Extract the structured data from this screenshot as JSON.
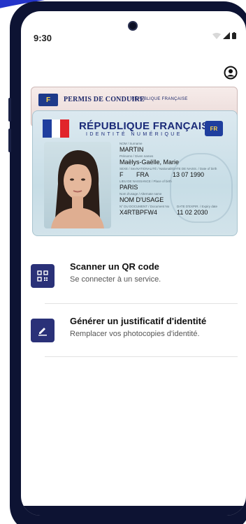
{
  "status": {
    "time": "9:30"
  },
  "card_back": {
    "flag_label": "F",
    "title": "PERMIS DE CONDUIRE",
    "subtitle": "RÉPUBLIQUE FRANÇAISE"
  },
  "card_front": {
    "title": "RÉPUBLIQUE FRANÇAISE",
    "subtitle": "IDENTITÉ NUMÉRIQUE",
    "eu_label": "FR",
    "fields": {
      "surname_label": "NOM / Surname",
      "surname": "MARTIN",
      "given_label": "Prénoms / Given names",
      "given": "Maëlys-Gaëlle, Marie",
      "sex_label": "SEXE / Sex",
      "sex": "F",
      "nationality_label": "NATIONALITÉ / Nationality",
      "nationality": "FRA",
      "birth_label": "DATE DE NAISS. / Date of birth",
      "birth": "13 07 1990",
      "place_label": "LIEU DE NAISSANCE / Place of birth",
      "place": "PARIS",
      "usage_label": "Nom d'usage / Alternate name",
      "usage": "NOM D'USAGE",
      "doc_label": "N° DU DOCUMENT / Document No",
      "doc": "X4RTBPFW4",
      "expiry_label": "DATE D'EXPIR. / Expiry date",
      "expiry": "11 02 2030"
    }
  },
  "menu": [
    {
      "title": "Scanner un QR code",
      "subtitle": "Se connecter à un service."
    },
    {
      "title": "Générer un justificatif d'identité",
      "subtitle": "Remplacer vos photocopies d'identité."
    }
  ],
  "colors": {
    "accent": "#2a3178",
    "frame": "#0d1333",
    "swoosh": "#2434c9"
  }
}
